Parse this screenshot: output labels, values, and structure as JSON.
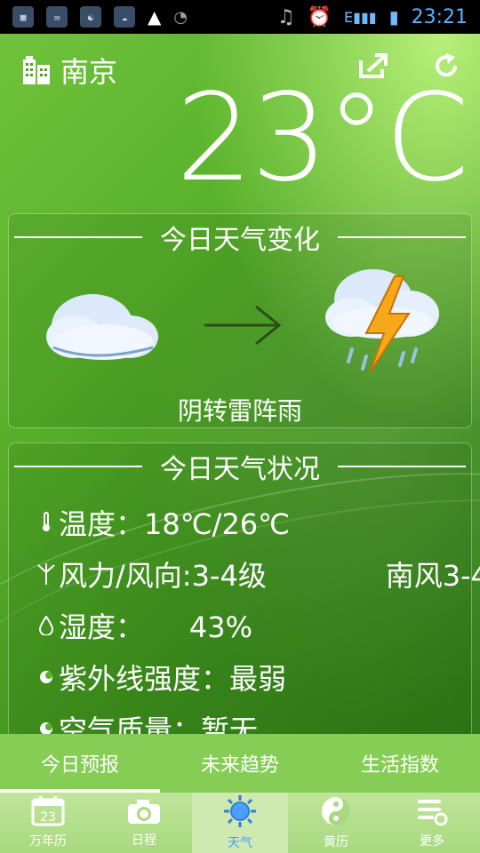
{
  "status_bar": {
    "notification_icons": [
      "calendar-icon",
      "message-icon",
      "app-icon",
      "weather-icon",
      "warning-icon",
      "android-icon"
    ],
    "time": "23:21",
    "network": "E"
  },
  "header": {
    "city": "南京",
    "temperature": "23°C"
  },
  "today_change": {
    "title": "今日天气变化",
    "condition": "阴转雷阵雨"
  },
  "today_status": {
    "title": "今日天气状况",
    "rows": [
      {
        "label": "温度：18℃/26℃",
        "icon": "thermometer-icon"
      },
      {
        "label": "风力/风向:3-4级",
        "extra": "南风3-4",
        "icon": "windmill-icon"
      },
      {
        "label": "湿度：     43%",
        "icon": "droplet-icon"
      },
      {
        "label": "紫外线强度：最弱",
        "icon": "dot-icon"
      },
      {
        "label": "空气质量：暂无",
        "icon": "dot-icon"
      }
    ]
  },
  "tabs": [
    {
      "label": "今日预报",
      "active": true
    },
    {
      "label": "未来趋势",
      "active": false
    },
    {
      "label": "生活指数",
      "active": false
    }
  ],
  "bottom_nav": [
    {
      "label": "万年历",
      "icon": "calendar-icon",
      "badge": "23"
    },
    {
      "label": "日程",
      "icon": "camera-icon"
    },
    {
      "label": "天气",
      "icon": "sun-icon",
      "active": true
    },
    {
      "label": "黄历",
      "icon": "yin-yang-icon"
    },
    {
      "label": "更多",
      "icon": "settings-list-icon"
    }
  ],
  "colors": {
    "accent_blue": "#4aa0ff",
    "bg_green": "#58b02a",
    "tab_green": "#8cd25a"
  }
}
